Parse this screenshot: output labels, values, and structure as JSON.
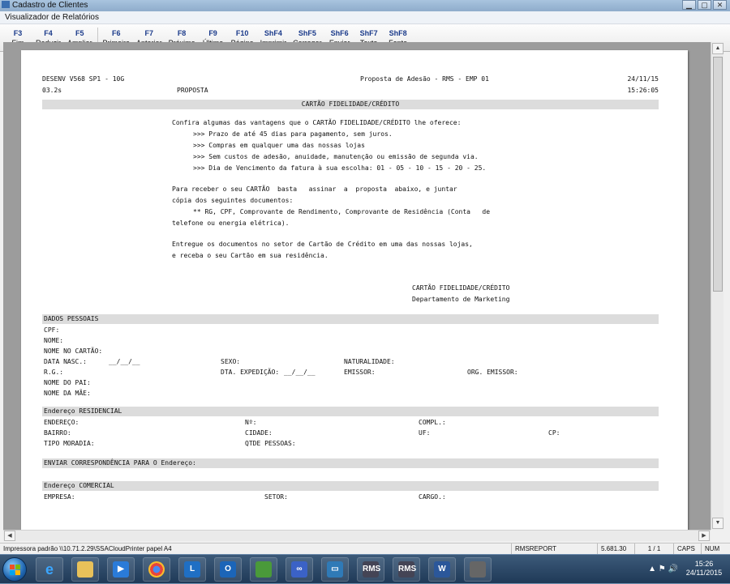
{
  "outer_window": {
    "title": "Cadastro de Clientes"
  },
  "window": {
    "title": "Visualizador de Relatórios"
  },
  "toolbar": [
    {
      "key": "F3",
      "label": "Fim"
    },
    {
      "key": "F4",
      "label": "Reduzir"
    },
    {
      "key": "F5",
      "label": "Ampliar"
    },
    {
      "key": "F6",
      "label": "Primeira"
    },
    {
      "key": "F7",
      "label": "Anterior"
    },
    {
      "key": "F8",
      "label": "Próxima"
    },
    {
      "key": "F9",
      "label": "Última"
    },
    {
      "key": "F10",
      "label": "Página"
    },
    {
      "key": "ShF4",
      "label": "Imprimir"
    },
    {
      "key": "ShF5",
      "label": "Carregar"
    },
    {
      "key": "ShF6",
      "label": "Enviar"
    },
    {
      "key": "ShF7",
      "label": "Texto"
    },
    {
      "key": "ShF8",
      "label": "Fonte"
    }
  ],
  "report": {
    "header": {
      "system": "DESENV V568 SP1 - 10G",
      "version": "03.2s",
      "section": "PROPOSTA",
      "title": "Proposta de Adesão - RMS - EMP 01",
      "date": "24/11/15",
      "time": "15:26:05"
    },
    "card_title": "CARTÃO FIDELIDADE/CRÉDITO",
    "benefits_intro": "Confira algumas das vantagens que o CARTÃO FIDELIDADE/CRÉDITO lhe oferece:",
    "benefits": [
      ">>> Prazo de até 45 dias para pagamento, sem juros.",
      ">>> Compras em qualquer uma das nossas lojas",
      ">>> Sem custos de adesão, anuidade, manutenção ou emissão de segunda via.",
      ">>> Dia de Vencimento da fatura à sua escolha: 01 - 05 - 10 - 15 - 20 - 25."
    ],
    "docs_line1": "Para receber o seu CARTÃO  basta   assinar  a  proposta  abaixo, e juntar",
    "docs_line2": "cópia dos seguintes documentos:",
    "docs_line3": "** RG, CPF, Comprovante de Rendimento, Comprovante de Residência (Conta   de",
    "docs_line4": "telefone ou energia elétrica).",
    "deliver_line1": "Entregue os documentos no setor de Cartão de Crédito em uma das nossas lojas,",
    "deliver_line2": "e receba o seu Cartão em sua residência.",
    "signature_line1": "CARTÃO FIDELIDADE/CRÉDITO",
    "signature_line2": "Departamento de Marketing",
    "sections": {
      "personal": "DADOS PESSOAIS",
      "residential": "Endereço RESIDENCIAL",
      "correspondence": "ENVIAR CORRESPONDÊNCIA PARA O Endereço:",
      "commercial": "Endereço COMERCIAL"
    },
    "fields": {
      "cpf": "CPF:",
      "nome": "NOME:",
      "nome_cartao": "NOME NO CARTÃO:",
      "data_nasc": "DATA NASC.:",
      "data_nasc_blank": "__/__/__",
      "sexo": "SEXO:",
      "naturalidade": "NATURALIDADE:",
      "rg": "R.G.:",
      "dta_expedicao": "DTA. EXPEDIÇÃO:",
      "dta_expedicao_blank": "__/__/__",
      "emissor": "EMISSOR:",
      "org_emissor": "ORG. EMISSOR:",
      "nome_pai": "NOME DO PAI:",
      "nome_mae": "NOME DA MÃE:",
      "endereco": "ENDEREÇO:",
      "numero": "Nº:",
      "compl": "COMPL.:",
      "bairro": "BAIRRO:",
      "cidade": "CIDADE:",
      "uf": "UF:",
      "cp": "CP:",
      "tipo_moradia": "TIPO MORADIA:",
      "qtde_pessoas": "QTDE PESSOAS:",
      "empresa": "EMPRESA:",
      "setor": "SETOR:",
      "cargo": "CARGO.:"
    }
  },
  "statusbar": {
    "printer": "Impressora padrão \\\\10.71.2.29\\SSACloudPrinter papel A4",
    "module": "RMSREPORT",
    "zoom": "5.681.30",
    "pages": "1 / 1",
    "caps": "CAPS",
    "num": "NUM"
  },
  "taskbar": {
    "time": "15:26",
    "date": "24/11/2015"
  }
}
